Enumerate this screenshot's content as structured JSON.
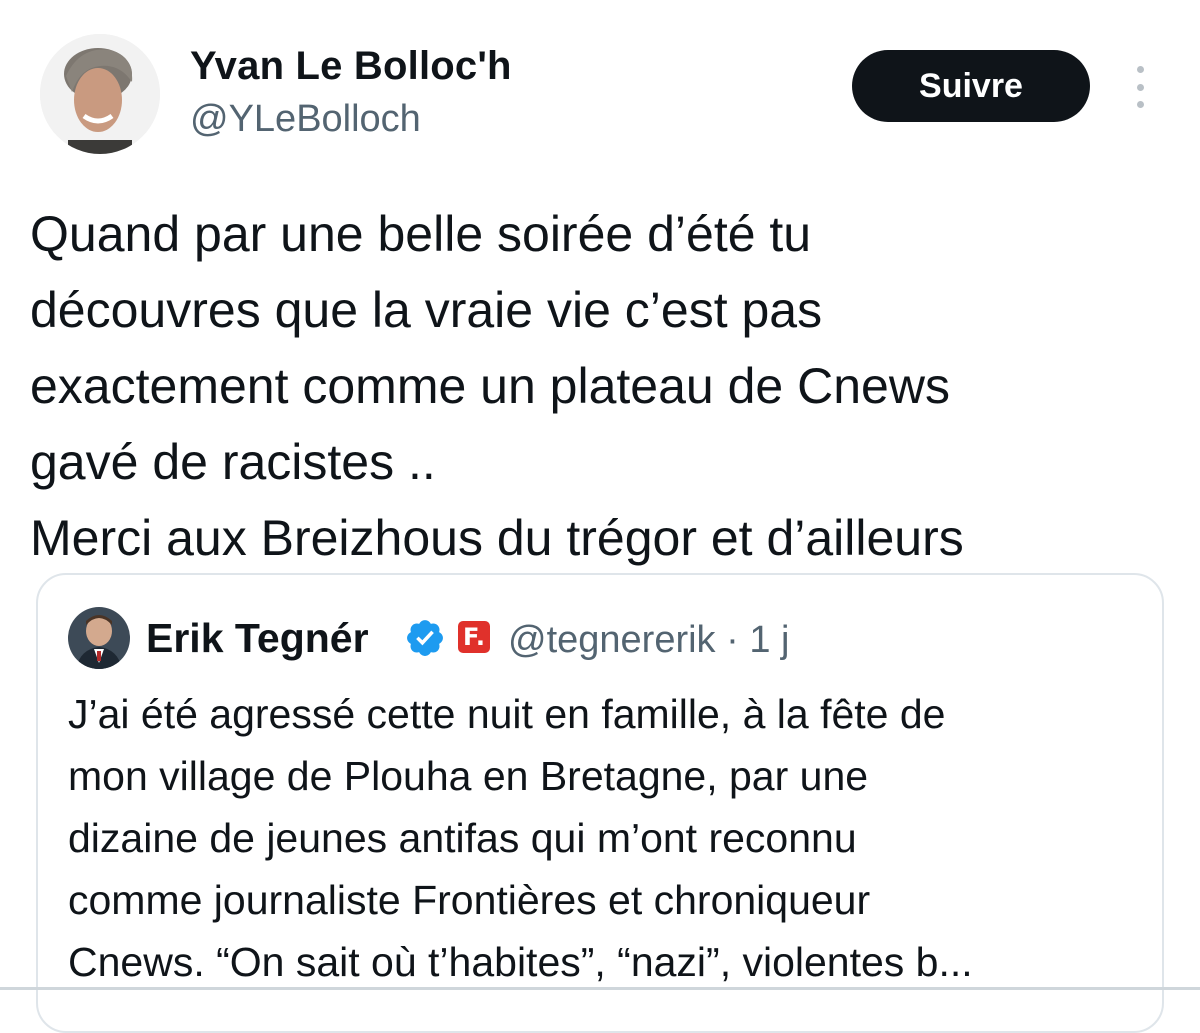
{
  "author": {
    "display_name": "Yvan Le Bolloc'h",
    "handle": "@YLeBolloch"
  },
  "actions": {
    "follow_label": "Suivre",
    "more_icon": "more-vertical-icon"
  },
  "tweet": {
    "text": "Quand par une belle soirée d’été tu\ndécouvres que la vraie vie  c’est pas\nexactement comme un plateau de Cnews\ngavé de racistes ..\nMerci aux Breizhous du trégor et d’ailleurs"
  },
  "quoted_tweet": {
    "display_name": "Erik Tegnér",
    "verified_icon": "verified-badge-icon",
    "affiliation_badge": "F.",
    "meta": "@tegnererik · 1 j",
    "text": "J’ai été agressé cette nuit en famille, à la fête de\nmon village de Plouha en Bretagne, par une\ndizaine de jeunes antifas qui m’ont reconnu\ncomme journaliste Frontières et chroniqueur\nCnews. “On sait où t’habites”, “nazi”, violentes b..."
  },
  "colors": {
    "text": "#0f1419",
    "secondary": "#536471",
    "verified_blue": "#1d9bf0",
    "button_bg": "#0f1419",
    "affiliation_red": "#e0312b"
  }
}
